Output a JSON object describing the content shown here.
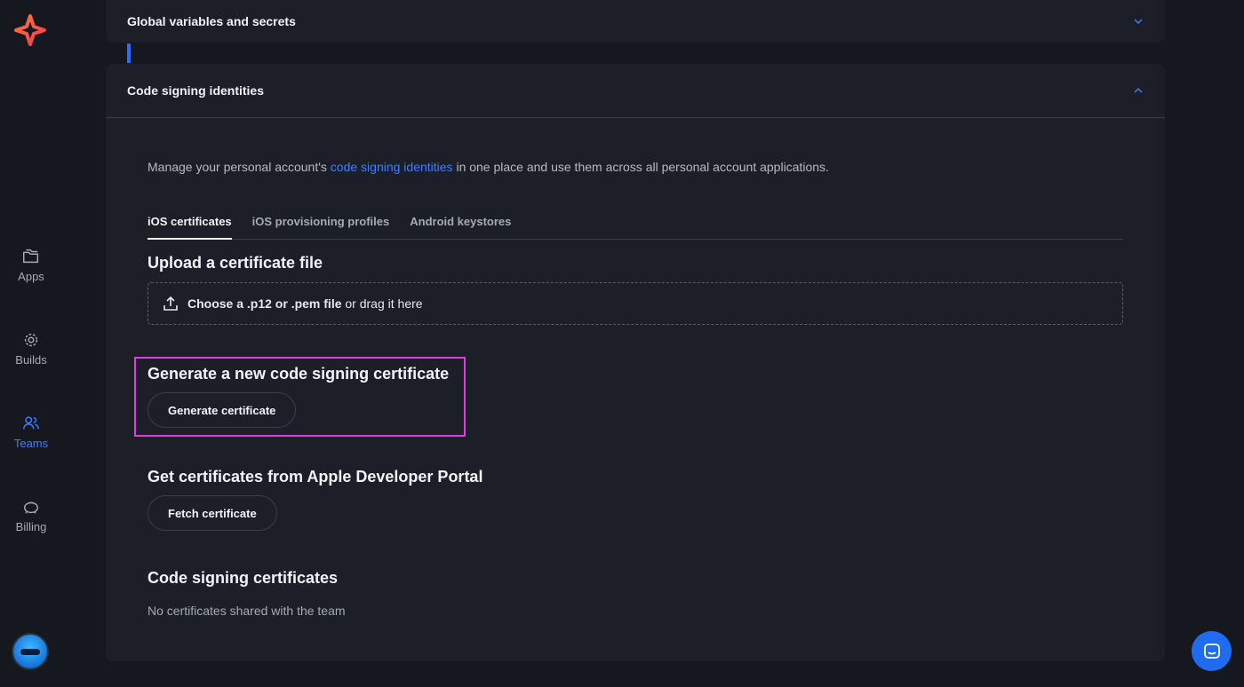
{
  "sidebar": {
    "items": [
      {
        "label": "Apps",
        "icon": "folder-icon"
      },
      {
        "label": "Builds",
        "icon": "builds-icon"
      },
      {
        "label": "Teams",
        "icon": "teams-icon",
        "active": true
      },
      {
        "label": "Billing",
        "icon": "piggy-bank-icon"
      }
    ]
  },
  "sections": {
    "global": {
      "title": "Global variables and secrets"
    },
    "codesign": {
      "title": "Code signing identities"
    }
  },
  "description": {
    "before": "Manage your personal account's ",
    "link": "code signing identities",
    "after": " in one place and use them across all personal account applications."
  },
  "tabs": [
    {
      "label": "iOS certificates",
      "active": true
    },
    {
      "label": "iOS provisioning profiles"
    },
    {
      "label": "Android keystores"
    }
  ],
  "upload": {
    "heading": "Upload a certificate file",
    "choose": "Choose a .p12 or .pem file",
    "drag": " or drag it here"
  },
  "generate": {
    "heading": "Generate a new code signing certificate",
    "button": "Generate certificate"
  },
  "fetch": {
    "heading": "Get certificates from Apple Developer Portal",
    "button": "Fetch certificate"
  },
  "list": {
    "heading": "Code signing certificates",
    "empty": "No certificates shared with the team"
  },
  "colors": {
    "accent": "#3f7dff",
    "highlight": "#e23be0",
    "background": "#16181f",
    "card": "#1c1f28"
  }
}
